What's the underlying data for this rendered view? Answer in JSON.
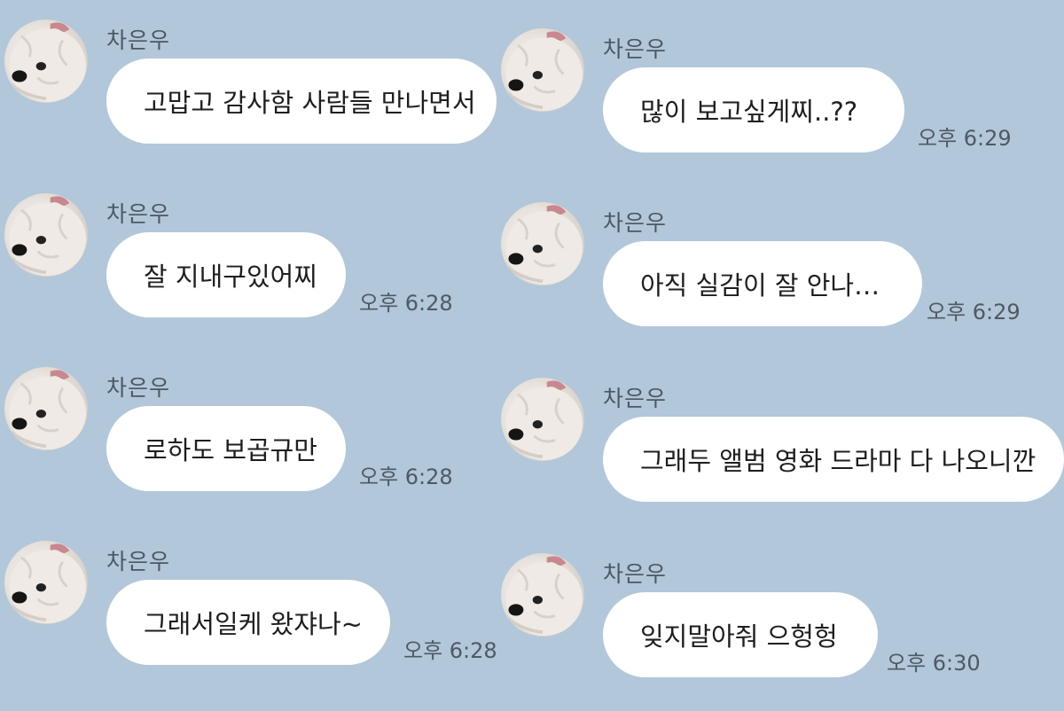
{
  "chat": {
    "left_column": [
      {
        "sender": "차은우",
        "text": "고맙고 감사함 사람들 만나면서",
        "time": ""
      },
      {
        "sender": "차은우",
        "text": "잘 지내구있어찌",
        "time": "오후 6:28"
      },
      {
        "sender": "차은우",
        "text": "로하도 보곱규만",
        "time": "오후 6:28"
      },
      {
        "sender": "차은우",
        "text": "그래서일케 왔쟈나~",
        "time": "오후 6:28"
      }
    ],
    "right_column": [
      {
        "sender": "차은우",
        "text": "많이 보고싶게찌..??",
        "time": "오후 6:29"
      },
      {
        "sender": "차은우",
        "text": "아직 실감이 잘 안나…",
        "time": "오후 6:29"
      },
      {
        "sender": "차은우",
        "text": "그래두 앨범 영화 드라마 다 나오니깐",
        "time": ""
      },
      {
        "sender": "차은우",
        "text": "잊지말아줘 으헝헝",
        "time": "오후 6:30"
      }
    ]
  },
  "colors": {
    "background": "#b2c7d9",
    "bubble": "#ffffff",
    "text": "#1e1e1e",
    "meta_text": "#4f5966"
  },
  "icons": {
    "avatar": "white-puppy-avatar"
  }
}
